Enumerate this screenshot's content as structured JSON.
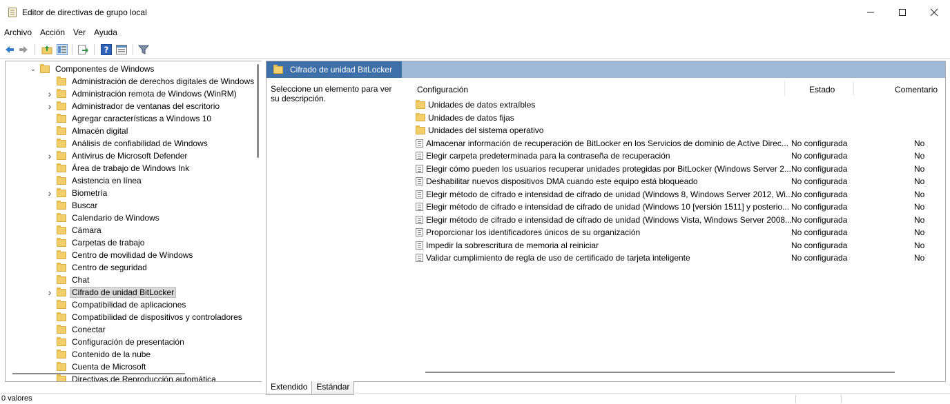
{
  "window": {
    "title": "Editor de directivas de grupo local"
  },
  "menu": [
    "Archivo",
    "Acción",
    "Ver",
    "Ayuda"
  ],
  "tree": [
    {
      "label": "Componentes de Windows",
      "expander": "open",
      "indent": 0
    },
    {
      "label": "Administración de derechos digitales de Windows",
      "expander": "",
      "indent": 1
    },
    {
      "label": "Administración remota de Windows (WinRM)",
      "expander": "closed",
      "indent": 1
    },
    {
      "label": "Administrador de ventanas del escritorio",
      "expander": "closed",
      "indent": 1
    },
    {
      "label": "Agregar características a Windows 10",
      "expander": "",
      "indent": 1
    },
    {
      "label": "Almacén digital",
      "expander": "",
      "indent": 1
    },
    {
      "label": "Análisis de confiabilidad de Windows",
      "expander": "",
      "indent": 1
    },
    {
      "label": "Antivirus de Microsoft Defender",
      "expander": "closed",
      "indent": 1
    },
    {
      "label": "Área de trabajo de Windows Ink",
      "expander": "",
      "indent": 1
    },
    {
      "label": "Asistencia en línea",
      "expander": "",
      "indent": 1
    },
    {
      "label": "Biometría",
      "expander": "closed",
      "indent": 1
    },
    {
      "label": "Buscar",
      "expander": "",
      "indent": 1
    },
    {
      "label": "Calendario de Windows",
      "expander": "",
      "indent": 1
    },
    {
      "label": "Cámara",
      "expander": "",
      "indent": 1
    },
    {
      "label": "Carpetas de trabajo",
      "expander": "",
      "indent": 1
    },
    {
      "label": "Centro de movilidad de Windows",
      "expander": "",
      "indent": 1
    },
    {
      "label": "Centro de seguridad",
      "expander": "",
      "indent": 1
    },
    {
      "label": "Chat",
      "expander": "",
      "indent": 1
    },
    {
      "label": "Cifrado de unidad BitLocker",
      "expander": "closed",
      "indent": 1,
      "selected": true
    },
    {
      "label": "Compatibilidad de aplicaciones",
      "expander": "",
      "indent": 1
    },
    {
      "label": "Compatibilidad de dispositivos y controladores",
      "expander": "",
      "indent": 1
    },
    {
      "label": "Conectar",
      "expander": "",
      "indent": 1
    },
    {
      "label": "Configuración de presentación",
      "expander": "",
      "indent": 1
    },
    {
      "label": "Contenido de la nube",
      "expander": "",
      "indent": 1
    },
    {
      "label": "Cuenta de Microsoft",
      "expander": "",
      "indent": 1
    },
    {
      "label": "Directivas de Reproducción automática",
      "expander": "",
      "indent": 1
    }
  ],
  "right": {
    "header": "Cifrado de unidad BitLocker",
    "description": "Seleccione un elemento para ver su descripción.",
    "columns": {
      "setting": "Configuración",
      "state": "Estado",
      "comment": "Comentario"
    },
    "folders": [
      "Unidades de datos extraíbles",
      "Unidades de datos fijas",
      "Unidades del sistema operativo"
    ],
    "settings": [
      {
        "name": "Almacenar información de recuperación de BitLocker en los Servicios de dominio de Active Direc...",
        "state": "No configurada",
        "comment": "No"
      },
      {
        "name": "Elegir carpeta predeterminada para la contraseña de recuperación",
        "state": "No configurada",
        "comment": "No"
      },
      {
        "name": "Elegir cómo pueden los usuarios recuperar unidades protegidas por BitLocker (Windows Server 2...",
        "state": "No configurada",
        "comment": "No"
      },
      {
        "name": "Deshabilitar nuevos dispositivos DMA cuando este equipo está bloqueado",
        "state": "No configurada",
        "comment": "No"
      },
      {
        "name": "Elegir método de cifrado e intensidad de cifrado de unidad (Windows 8, Windows Server 2012, Wi...",
        "state": "No configurada",
        "comment": "No"
      },
      {
        "name": "Elegir método de cifrado e intensidad de cifrado de unidad (Windows 10 [versión 1511] y posterio...",
        "state": "No configurada",
        "comment": "No"
      },
      {
        "name": "Elegir método de cifrado e intensidad de cifrado de unidad (Windows Vista, Windows Server 2008...",
        "state": "No configurada",
        "comment": "No"
      },
      {
        "name": "Proporcionar los identificadores únicos de su organización",
        "state": "No configurada",
        "comment": "No"
      },
      {
        "name": "Impedir la sobrescritura de memoria al reiniciar",
        "state": "No configurada",
        "comment": "No"
      },
      {
        "name": "Validar cumplimiento de regla de uso de certificado de tarjeta inteligente",
        "state": "No configurada",
        "comment": "No"
      }
    ]
  },
  "tabs": [
    "Extendido",
    "Estándar"
  ],
  "status": {
    "text": "0 valores"
  },
  "colors": {
    "header_tab": "#3d6fa8",
    "header_bar": "#9fb8d6",
    "folder": "#f2cf6b"
  }
}
